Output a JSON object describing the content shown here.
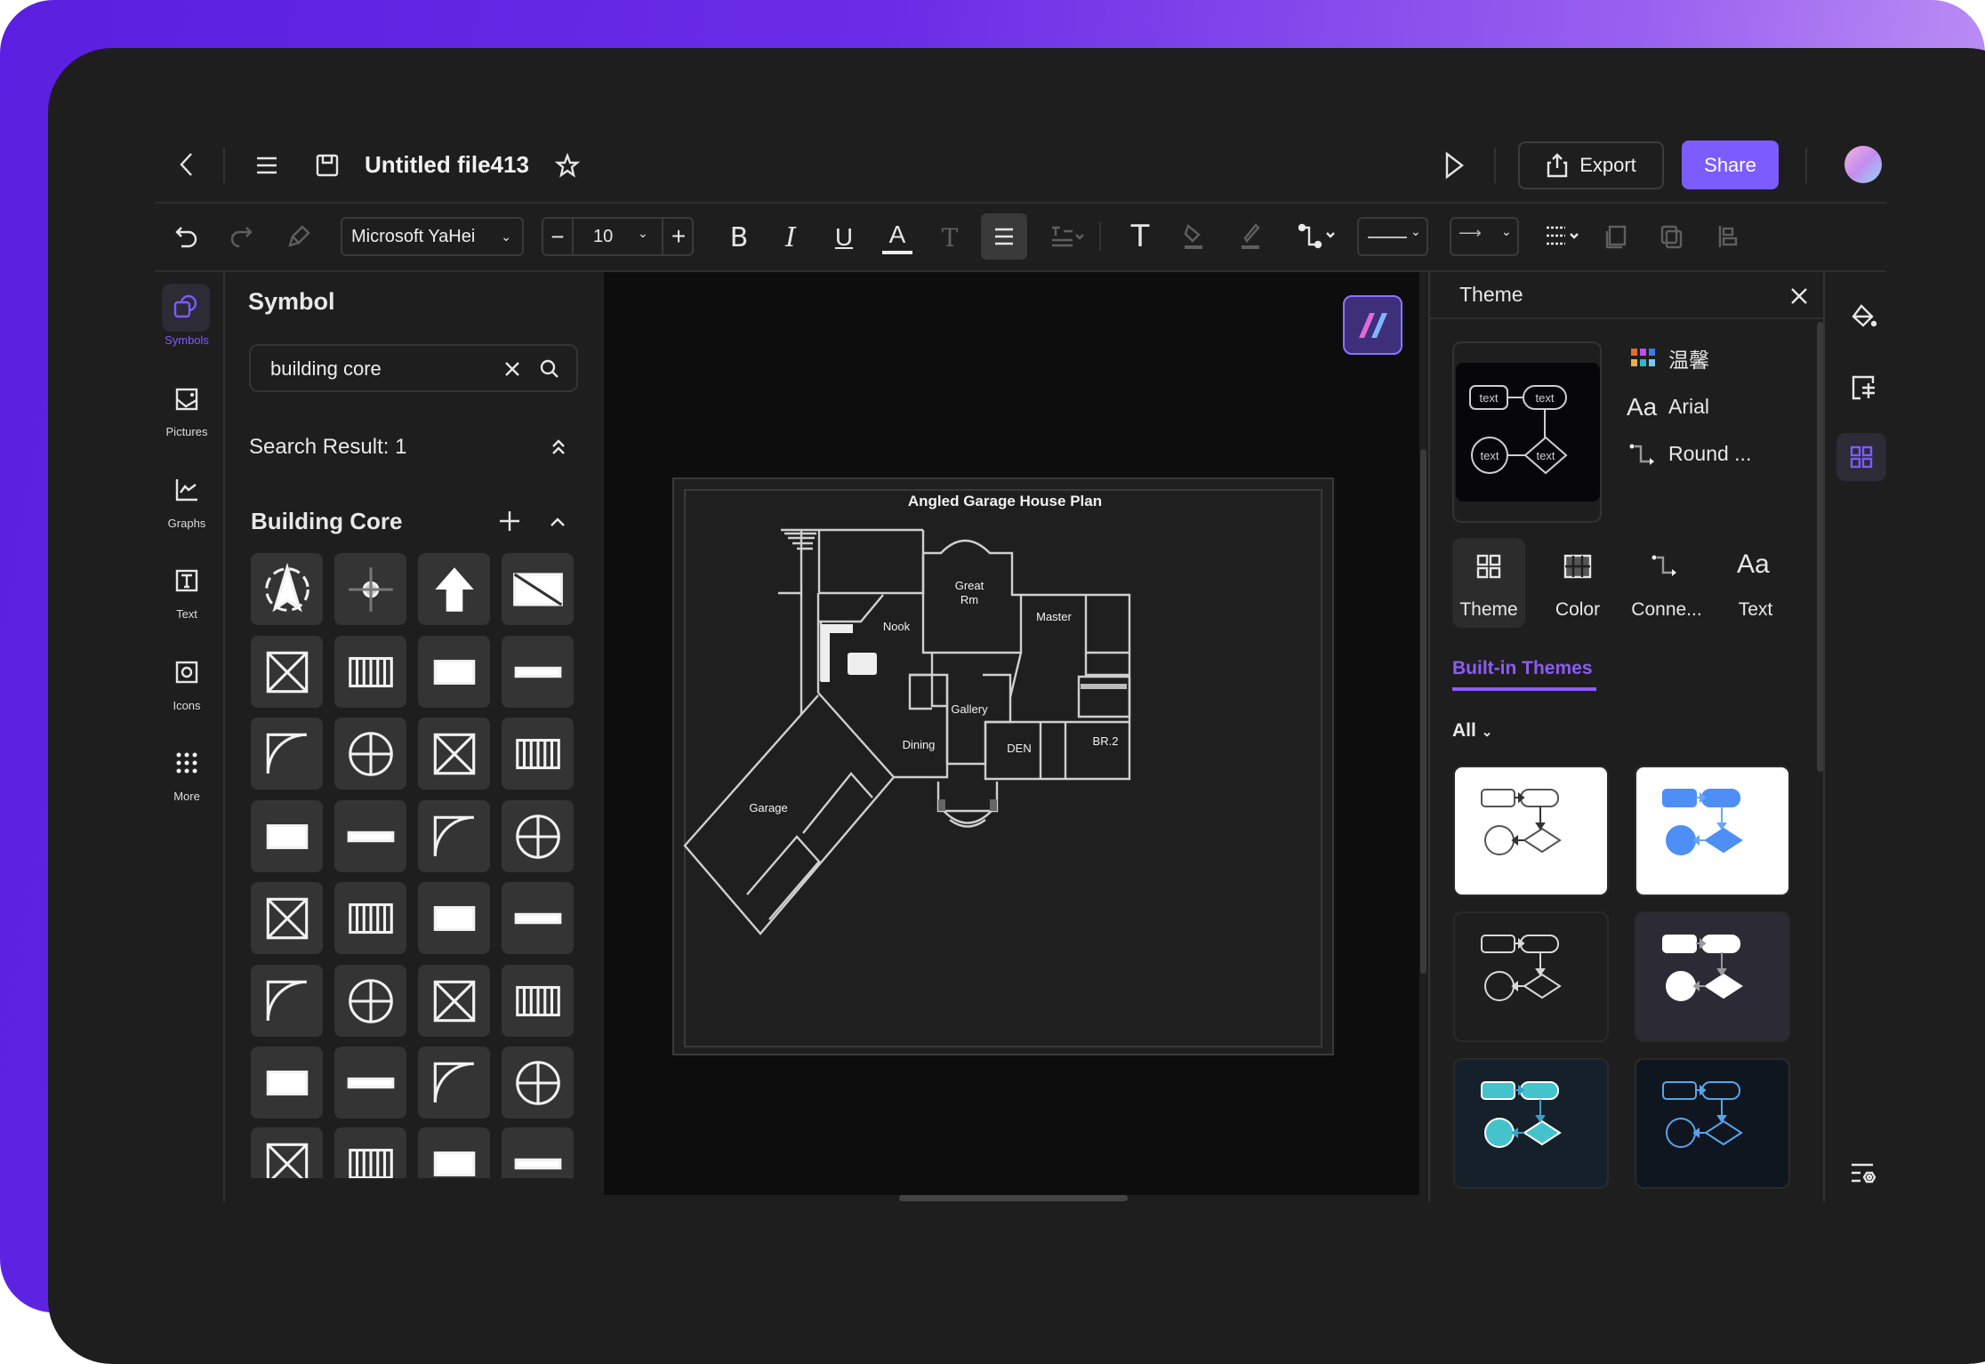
{
  "header": {
    "title": "Untitled file413",
    "export_label": "Export",
    "share_label": "Share",
    "accent": "#7c5cff"
  },
  "toolbar": {
    "font": "Microsoft YaHei",
    "font_size": "10"
  },
  "rail": {
    "items": [
      {
        "label": "Symbols",
        "icon": "symbols-icon"
      },
      {
        "label": "Pictures",
        "icon": "picture-icon"
      },
      {
        "label": "Graphs",
        "icon": "graph-icon"
      },
      {
        "label": "Text",
        "icon": "text-icon"
      },
      {
        "label": "Icons",
        "icon": "icons-icon"
      },
      {
        "label": "More",
        "icon": "more-grid-icon"
      }
    ]
  },
  "symbol_panel": {
    "title": "Symbol",
    "search_value": "building core",
    "search_result": "Search Result: 1",
    "category": "Building Core",
    "symbols": [
      "compass-north",
      "compass-rose",
      "arrow-up",
      "rectangle-diagonal",
      "square-corner",
      "wall-bar",
      "door-swing",
      "stair-block",
      "stair-straight",
      "stair-curved",
      "stair-spiral",
      "stair-l",
      "stair-u",
      "stair-landing",
      "wall-thin",
      "wall-dashed",
      "spiral-stair-a",
      "spiral-stair-b",
      "triangle-panel",
      "door-quarter",
      "vent-grille",
      "wall-solid",
      "wall-curve",
      "wall-corner",
      "toilet",
      "double-circle",
      "sink-pair",
      "fixture-pair",
      "circle-fixture",
      "counter",
      "box-x",
      "box-x-wide"
    ]
  },
  "canvas": {
    "plan_title": "Angled Garage House Plan",
    "rooms": {
      "nook": "Nook",
      "great": "Great",
      "great2": "Rm",
      "master": "Master",
      "gallery": "Gallery",
      "dining": "Dining",
      "den": "DEN",
      "br2": "BR.2",
      "garage": "Garage"
    }
  },
  "theme_panel": {
    "title": "Theme",
    "current": {
      "palette_name": "温馨",
      "font_sample": "Aa",
      "font": "Arial",
      "connector": "Round ...",
      "node_text": "text"
    },
    "tabs": [
      {
        "label": "Theme"
      },
      {
        "label": "Color"
      },
      {
        "label": "Conne..."
      },
      {
        "label": "Text"
      }
    ],
    "section": "Built-in Themes",
    "filter": "All",
    "accent": "#8b5cf6",
    "themes": [
      {
        "bg": "#ffffff",
        "stroke": "#555555",
        "fill": "none",
        "arrow": "#333333"
      },
      {
        "bg": "#ffffff",
        "stroke": "#4e8ef7",
        "fill": "#4e8ef7",
        "arrow": "#6aa6f8"
      },
      {
        "bg": "#1e1e1e",
        "stroke": "#d8d8d8",
        "fill": "none",
        "arrow": "#d8d8d8"
      },
      {
        "bg": "#2b2a35",
        "stroke": "#ffffff",
        "fill": "#ffffff",
        "arrow": "#9a9a9a"
      },
      {
        "bg": "#16202b",
        "stroke": "#ffffff",
        "fill": "#45c3cc",
        "arrow": "#3aa0c8"
      },
      {
        "bg": "#0f1620",
        "stroke": "#5aa4e8",
        "fill": "none",
        "arrow": "#5aa4e8"
      }
    ]
  }
}
